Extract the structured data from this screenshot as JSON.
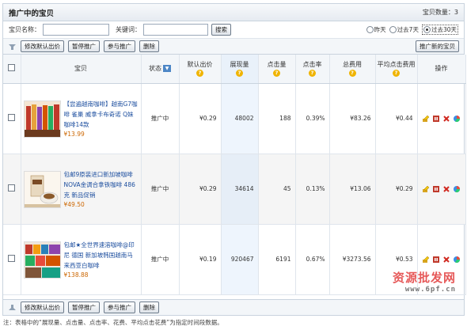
{
  "header": {
    "title": "推广中的宝贝",
    "count_label": "宝贝数量：3"
  },
  "search": {
    "name_label": "宝贝名称：",
    "keyword_label": "关键词：",
    "name_value": "",
    "keyword_value": "",
    "search_button": "搜索",
    "ranges": [
      {
        "label": "昨天",
        "selected": false
      },
      {
        "label": "过去7天",
        "selected": false
      },
      {
        "label": "过去30天",
        "selected": true
      }
    ]
  },
  "actions": {
    "modify_bid": "修改默认出价",
    "pause": "暂停推广",
    "join": "参与推广",
    "delete": "删除",
    "promote_new": "推广新的宝贝"
  },
  "table": {
    "columns": [
      "宝贝",
      "状态",
      "默认出价",
      "展现量",
      "点击量",
      "点击率",
      "总费用",
      "平均点击费用",
      "操作"
    ],
    "rows": [
      {
        "name": "【尝遍越南咖啡】越南G7咖啡 雀巢 威拿卡布奇诺 Q妹咖啡14款",
        "price": "¥13.99",
        "status": "推广中",
        "bid": "¥0.29",
        "impressions": "48002",
        "clicks": "188",
        "ctr": "0.39%",
        "cost": "¥83.26",
        "avg_cpc": "¥0.44"
      },
      {
        "name": "包邮9原装进口新加坡咖啡 NOVA金调合拿铁咖啡 486克 新品促销",
        "price": "¥49.50",
        "status": "推广中",
        "bid": "¥0.29",
        "impressions": "34614",
        "clicks": "45",
        "ctr": "0.13%",
        "cost": "¥13.06",
        "avg_cpc": "¥0.29"
      },
      {
        "name": "包邮★全世界速溶咖啡@印尼 德国 新加坡韩国越南马来西亚白咖啡",
        "price": "¥138.88",
        "status": "推广中",
        "bid": "¥0.19",
        "impressions": "920467",
        "clicks": "6191",
        "ctr": "0.67%",
        "cost": "¥3273.56",
        "avg_cpc": "¥0.53"
      }
    ]
  },
  "note": "注：表格中的“展现量、点击量、点击率、花费、平均点击花费”为指定时间段数据。",
  "watermark": {
    "text": "资源批发网",
    "sub": "www.6pf.cn"
  },
  "colors": {
    "link": "#1b4d9e",
    "price": "#cc6600",
    "header_bg": "#f3f6f9",
    "help": "#f0b400"
  }
}
